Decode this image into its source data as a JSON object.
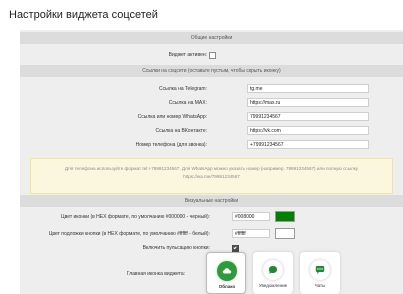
{
  "page": {
    "title": "Настройки виджета соцсетей"
  },
  "general": {
    "header": "Общие настройки",
    "active_label": "Виджет активен:",
    "active": false
  },
  "links": {
    "header": "Ссылки на соцсети (оставьте пустым, чтобы скрыть иконку)",
    "telegram_label": "Ссылка на Telegram:",
    "telegram_value": "tg.me",
    "max_label": "Ссылка на MAX:",
    "max_value": "https://max.ru",
    "whatsapp_label": "Ссылка или номер WhatsApp:",
    "whatsapp_value": "79991234567",
    "vk_label": "Ссылка на ВКонтакте:",
    "vk_value": "https://vk.com",
    "phone_label": "Номер телефона (для звонка):",
    "phone_value": "+79991234567"
  },
  "note": {
    "text": "Для телефона используйте формат tel:+79991234567. Для WhatsApp можно указать номер (например, 79991234567) или полную ссылку https://wa.me/79991234567"
  },
  "visual": {
    "header": "Визуальные настройки",
    "icon_color_label": "Цвет иконки (в HEX формате, по умолчанию #000000 - черный):",
    "icon_color_value": "#008000",
    "icon_color_swatch": "#008000",
    "bg_color_label": "Цвет подложки кнопки (в HEX формате, по умолчанию #ffffff - белый):",
    "bg_color_value": "#ffffff",
    "bg_color_swatch": "#ffffff",
    "pulse_label": "Включить пульсацию кнопки:",
    "pulse": true,
    "main_icon_label": "Главная иконка виджета:",
    "icons": [
      {
        "icon": "cloud-icon",
        "label": "Облако",
        "selected": true
      },
      {
        "icon": "chat-bubble-icon",
        "label": "Уведомление",
        "selected": false
      },
      {
        "icon": "chat-dots-icon",
        "label": "Чаты",
        "selected": false
      }
    ]
  }
}
